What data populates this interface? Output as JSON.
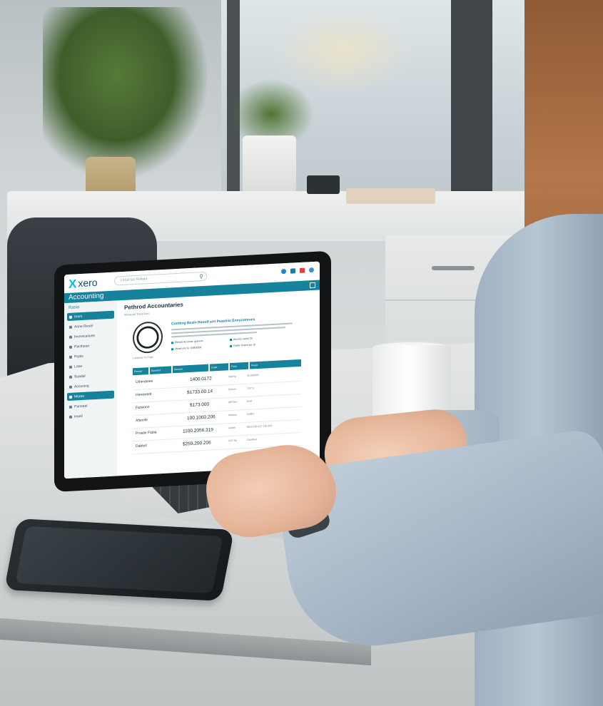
{
  "app": {
    "brand_mark": "X",
    "brand_name": "xero",
    "search_placeholder": "Local tax Reload",
    "section_title": "Accounting",
    "colors": {
      "brand": "#13b5ea",
      "accent": "#17829c",
      "icon_1": "#1e88c7",
      "icon_2": "#17829c",
      "icon_3": "#d9443c",
      "icon_4": "#3f8fc8"
    }
  },
  "sidebar": {
    "header": "Rasio",
    "items": [
      {
        "label": "Itrom",
        "icon": "home-icon",
        "active": true
      },
      {
        "label": "Arine Resal",
        "icon": "user-icon",
        "active": false
      },
      {
        "label": "Invovicatiuns",
        "icon": "document-icon",
        "active": false
      },
      {
        "label": "Pacthoon",
        "icon": "folder-icon",
        "active": false
      },
      {
        "label": "Prptis",
        "icon": "pencil-icon",
        "active": false
      },
      {
        "label": "Lnbe",
        "icon": "list-icon",
        "active": false
      },
      {
        "label": "Suadal",
        "icon": "chart-icon",
        "active": false
      },
      {
        "label": "Acconiriq",
        "icon": "calculator-icon",
        "active": false
      },
      {
        "label": "Mores",
        "icon": "settings-icon",
        "active": true
      },
      {
        "label": "Parcteel",
        "icon": "box-icon",
        "active": false
      },
      {
        "label": "Insell",
        "icon": "plus-icon",
        "active": false
      }
    ]
  },
  "main": {
    "title": "Pethrod Accountaries",
    "subtitle": "Pieraund Thcd Revi",
    "card_title": "Contting Bealn Raoolf arrt Peaetiiie Ennyromrees",
    "chips": [
      "Fbeard Acconos, gyteens",
      "Aucees Larad 3S",
      "Utoad uns fe. 04902006",
      "Ootter Uulpot wa 16"
    ],
    "avatar_caption": "Lonprese  Ya  Pags",
    "table_headers": [
      "Pevard",
      "Epoated",
      "Reviost",
      "Coatt",
      "Foos",
      "Peoer"
    ],
    "rows": [
      {
        "name": "Uthmatoes",
        "amount": "1400.0172",
        "label": "Valeng",
        "note": "40.000000"
      },
      {
        "name": "Honawsdr",
        "amount": "$1733.00.14",
        "label": "Feesm",
        "note": "7G7.9"
      },
      {
        "name": "Farsionn",
        "amount": "$173.000",
        "label": "WPTare",
        "note": "Eralt"
      },
      {
        "name": "Afsonfe",
        "amount": "100.1000.206",
        "label": "Reltase",
        "note": "Gatlhe"
      },
      {
        "name": "Proalie Fadia",
        "amount": "1100.2056.319",
        "label": "Uatsel",
        "note": "8013 100 LYT 100.103"
      },
      {
        "name": "Dabtell",
        "amount": "$259.200.206",
        "label": "SO7.6p",
        "note": "Oaattaiat"
      }
    ]
  }
}
